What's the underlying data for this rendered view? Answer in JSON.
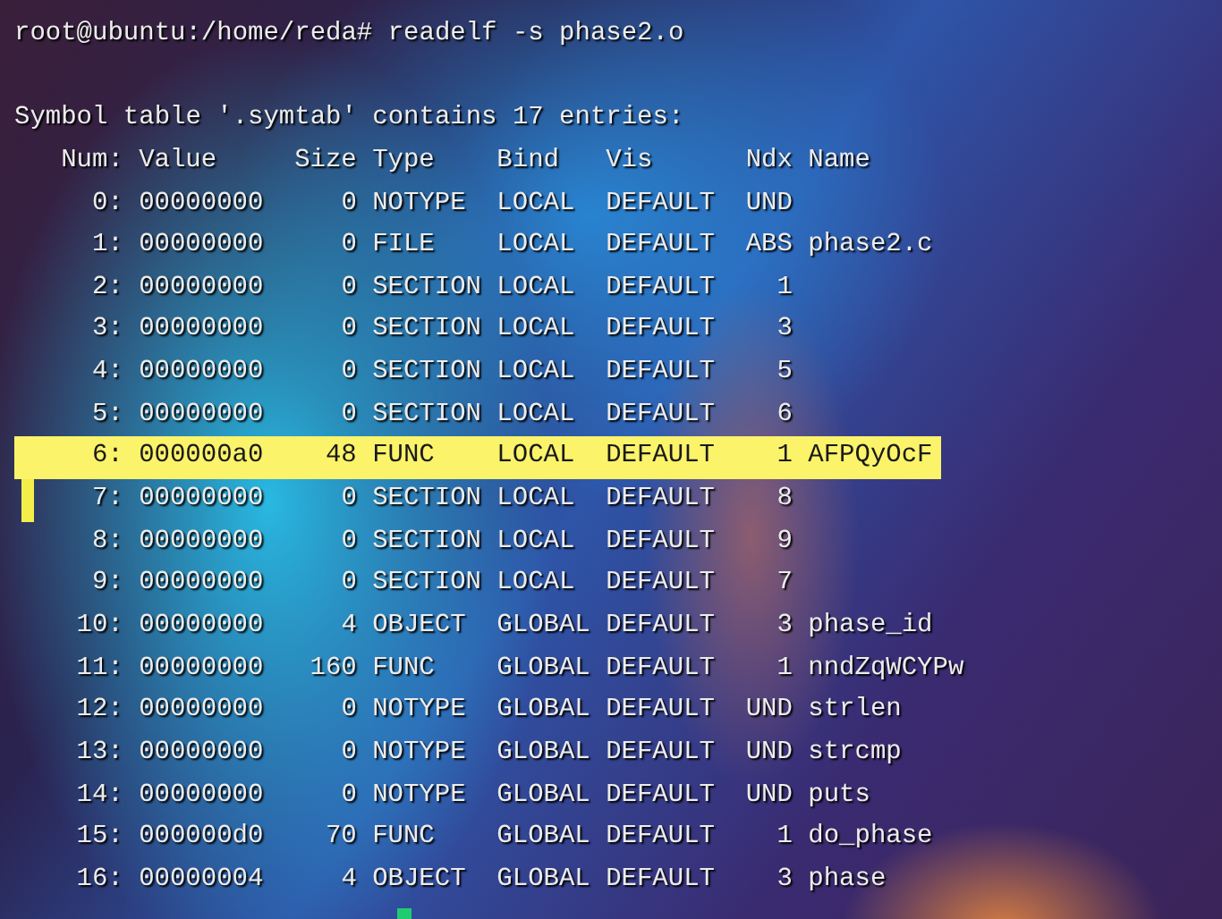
{
  "prompt": "root@ubuntu:/home/reda# readelf -s phase2.o",
  "summary": "Symbol table '.symtab' contains 17 entries:",
  "columns": [
    "Num:",
    "Value",
    "Size",
    "Type",
    "Bind",
    "Vis",
    "Ndx",
    "Name"
  ],
  "rows": [
    {
      "cells": [
        "0:",
        "00000000",
        "0",
        "NOTYPE",
        "LOCAL",
        "DEFAULT",
        "UND",
        ""
      ],
      "highlighted": false,
      "marker": false
    },
    {
      "cells": [
        "1:",
        "00000000",
        "0",
        "FILE",
        "LOCAL",
        "DEFAULT",
        "ABS",
        "phase2.c"
      ],
      "highlighted": false,
      "marker": false
    },
    {
      "cells": [
        "2:",
        "00000000",
        "0",
        "SECTION",
        "LOCAL",
        "DEFAULT",
        "1",
        ""
      ],
      "highlighted": false,
      "marker": false
    },
    {
      "cells": [
        "3:",
        "00000000",
        "0",
        "SECTION",
        "LOCAL",
        "DEFAULT",
        "3",
        ""
      ],
      "highlighted": false,
      "marker": false
    },
    {
      "cells": [
        "4:",
        "00000000",
        "0",
        "SECTION",
        "LOCAL",
        "DEFAULT",
        "5",
        ""
      ],
      "highlighted": false,
      "marker": false
    },
    {
      "cells": [
        "5:",
        "00000000",
        "0",
        "SECTION",
        "LOCAL",
        "DEFAULT",
        "6",
        ""
      ],
      "highlighted": false,
      "marker": false
    },
    {
      "cells": [
        "6:",
        "000000a0",
        "48",
        "FUNC",
        "LOCAL",
        "DEFAULT",
        "1",
        "AFPQyOcF"
      ],
      "highlighted": true,
      "marker": false
    },
    {
      "cells": [
        "7:",
        "00000000",
        "0",
        "SECTION",
        "LOCAL",
        "DEFAULT",
        "8",
        ""
      ],
      "highlighted": false,
      "marker": true
    },
    {
      "cells": [
        "8:",
        "00000000",
        "0",
        "SECTION",
        "LOCAL",
        "DEFAULT",
        "9",
        ""
      ],
      "highlighted": false,
      "marker": false
    },
    {
      "cells": [
        "9:",
        "00000000",
        "0",
        "SECTION",
        "LOCAL",
        "DEFAULT",
        "7",
        ""
      ],
      "highlighted": false,
      "marker": false
    },
    {
      "cells": [
        "10:",
        "00000000",
        "4",
        "OBJECT",
        "GLOBAL",
        "DEFAULT",
        "3",
        "phase_id"
      ],
      "highlighted": false,
      "marker": false
    },
    {
      "cells": [
        "11:",
        "00000000",
        "160",
        "FUNC",
        "GLOBAL",
        "DEFAULT",
        "1",
        "nndZqWCYPw"
      ],
      "highlighted": false,
      "marker": false
    },
    {
      "cells": [
        "12:",
        "00000000",
        "0",
        "NOTYPE",
        "GLOBAL",
        "DEFAULT",
        "UND",
        "strlen"
      ],
      "highlighted": false,
      "marker": false
    },
    {
      "cells": [
        "13:",
        "00000000",
        "0",
        "NOTYPE",
        "GLOBAL",
        "DEFAULT",
        "UND",
        "strcmp"
      ],
      "highlighted": false,
      "marker": false
    },
    {
      "cells": [
        "14:",
        "00000000",
        "0",
        "NOTYPE",
        "GLOBAL",
        "DEFAULT",
        "UND",
        "puts"
      ],
      "highlighted": false,
      "marker": false
    },
    {
      "cells": [
        "15:",
        "000000d0",
        "70",
        "FUNC",
        "GLOBAL",
        "DEFAULT",
        "1",
        "do_phase"
      ],
      "highlighted": false,
      "marker": false
    },
    {
      "cells": [
        "16:",
        "00000004",
        "4",
        "OBJECT",
        "GLOBAL",
        "DEFAULT",
        "3",
        "phase"
      ],
      "highlighted": false,
      "marker": false
    }
  ],
  "cursor_visible": true
}
